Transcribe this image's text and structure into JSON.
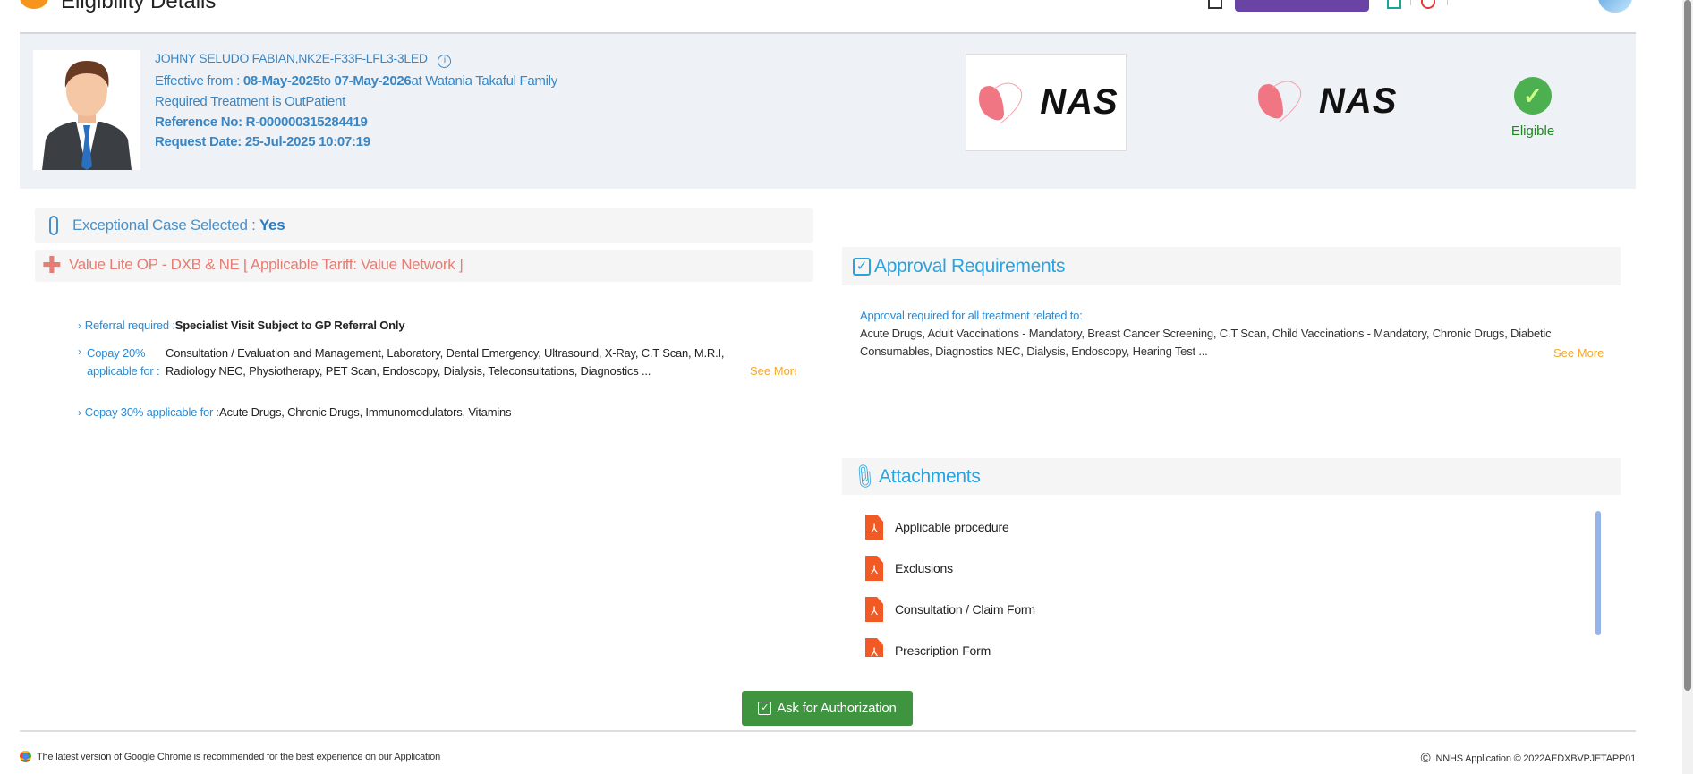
{
  "header": {
    "title": "Eligibility Details"
  },
  "member": {
    "name_id": "JOHNY SELUDO FABIAN,NK2E-F33F-LFL3-3LED",
    "effective_prefix": "Effective from : ",
    "effective_from": "08-May-2025",
    "to_label": "to ",
    "effective_to": "07-May-2026",
    "at_label": "at Watania Takaful Family",
    "treatment": "Required Treatment is OutPatient",
    "reference": "Reference No: R-000000315284419",
    "request_date": "Request Date: 25-Jul-2025 10:07:19"
  },
  "logos": {
    "payer": "NAS",
    "tpa": "NAS"
  },
  "status": {
    "label": "Eligible",
    "color": "#4caf50"
  },
  "exceptional": {
    "label": "Exceptional Case Selected : ",
    "value": "Yes"
  },
  "plan": {
    "title": "Value Lite OP - DXB & NE [ Applicable Tariff: Value Network ]"
  },
  "benefits": [
    {
      "label": "Referral required :",
      "value": "Specialist Visit Subject to GP Referral Only"
    },
    {
      "label": "Copay 20% applicable for :",
      "value": "Consultation / Evaluation and Management, Laboratory, Dental Emergency, Ultrasound, X-Ray, C.T Scan, M.R.I, Radiology NEC, Physiotherapy, PET Scan, Endoscopy, Dialysis, Teleconsultations, Diagnostics ...",
      "see_more": "See More"
    },
    {
      "label": "Copay 30% applicable for :",
      "value": "Acute Drugs, Chronic Drugs, Immunomodulators, Vitamins"
    }
  ],
  "approval": {
    "title": "Approval Requirements",
    "intro": "Approval required for all treatment related to:",
    "line1": "Acute Drugs, Adult Vaccinations - Mandatory, Breast Cancer Screening, C.T Scan, Child Vaccinations - Mandatory, Chronic Drugs, Diabetic",
    "line2": "Consumables, Diagnostics NEC, Dialysis, Endoscopy, Hearing Test ...",
    "see_more": "See More"
  },
  "attachments": {
    "title": "Attachments",
    "items": [
      "Applicable procedure",
      "Exclusions",
      "Consultation / Claim Form",
      "Prescription Form"
    ]
  },
  "actions": {
    "ask_auth": "Ask for Authorization"
  },
  "footer": {
    "browser_note": "The latest version of Google Chrome is recommended for the best experience on our Application",
    "copyright": "NNHS Application © 2022AEDXBVPJETAPP01"
  }
}
